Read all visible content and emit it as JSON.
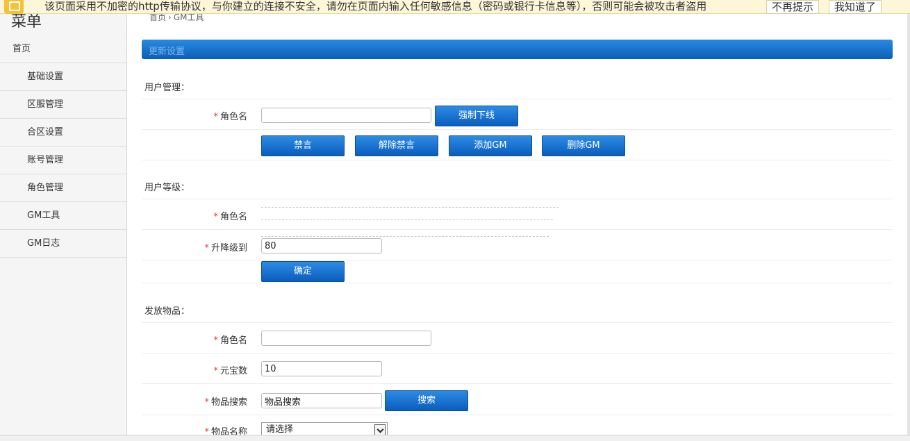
{
  "warning_bar": {
    "message": "该页面采用不加密的http传输协议，与你建立的连接不安全，请勿在页面内输入任何敏感信息（密码或银行卡信息等），否则可能会被攻击者盗用",
    "no_remind_label": "不再提示",
    "got_it_label": "我知道了"
  },
  "sidebar": {
    "title": "菜单",
    "home": "首页",
    "items": [
      "基础设置",
      "区服管理",
      "合区设置",
      "账号管理",
      "角色管理",
      "GM工具",
      "GM日志"
    ]
  },
  "breadcrumb": {
    "home": "首页",
    "sep": "›",
    "current": "GM工具"
  },
  "header": {
    "title": "更新设置"
  },
  "user_management": {
    "section_title": "用户管理：",
    "role_label": "角色名",
    "role_value": "",
    "force_offline_label": "强制下线",
    "mute_label": "禁言",
    "unmute_label": "解除禁言",
    "add_gm_label": "添加GM",
    "remove_gm_label": "删除GM"
  },
  "user_level": {
    "section_title": "用户等级：",
    "role_label": "角色名",
    "level_label": "升降级到",
    "level_value": "80",
    "confirm_label": "确定"
  },
  "give_items": {
    "section_title": "发放物品：",
    "role_label": "角色名",
    "role_value": "",
    "ingot_label": "元宝数",
    "ingot_value": "10",
    "search_label": "物品搜索",
    "search_value": "物品搜索",
    "search_button_label": "搜索",
    "item_name_label": "物品名称",
    "item_select_value": "请选择"
  },
  "required_mark": "*"
}
